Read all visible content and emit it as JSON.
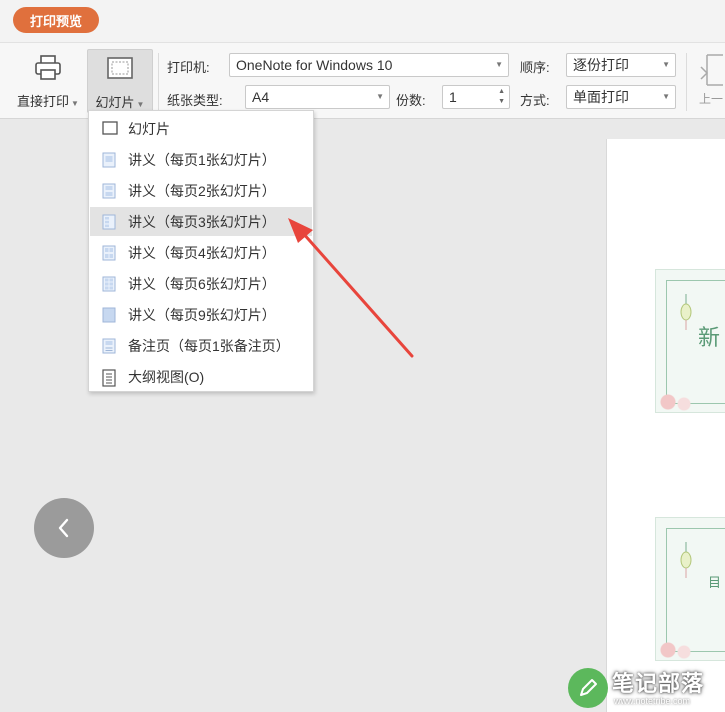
{
  "tab": {
    "label": "打印预览"
  },
  "toolbar": {
    "direct_print_label": "直接打印",
    "slides_label": "幻灯片",
    "printer_label": "打印机:",
    "printer_value": "OneNote for Windows 10",
    "paper_label": "纸张类型:",
    "paper_value": "A4",
    "copies_label": "份数:",
    "copies_value": "1",
    "order_label": "顺序:",
    "order_value": "逐份打印",
    "mode_label": "方式:",
    "mode_value": "单面打印",
    "prev_page_label": "上一"
  },
  "menu": {
    "items": [
      {
        "label": "幻灯片",
        "icon": "slide-icon"
      },
      {
        "label": "讲义（每页1张幻灯片）",
        "icon": "handout-1-icon"
      },
      {
        "label": "讲义（每页2张幻灯片）",
        "icon": "handout-2-icon"
      },
      {
        "label": "讲义（每页3张幻灯片）",
        "icon": "handout-3-icon",
        "highlighted": true
      },
      {
        "label": "讲义（每页4张幻灯片）",
        "icon": "handout-4-icon"
      },
      {
        "label": "讲义（每页6张幻灯片）",
        "icon": "handout-6-icon"
      },
      {
        "label": "讲义（每页9张幻灯片）",
        "icon": "handout-9-icon"
      },
      {
        "label": "备注页（每页1张备注页）",
        "icon": "notes-page-icon"
      },
      {
        "label": "大纲视图(O)",
        "icon": "outline-icon"
      }
    ]
  },
  "preview": {
    "slide1_text": "新",
    "slide2_text": "目"
  },
  "watermark": {
    "title": "笔记部落",
    "url": "www.notetribe.com"
  },
  "colors": {
    "accent": "#e0703d",
    "arrow": "#e8453c",
    "watermark_green": "#5cb85c"
  }
}
